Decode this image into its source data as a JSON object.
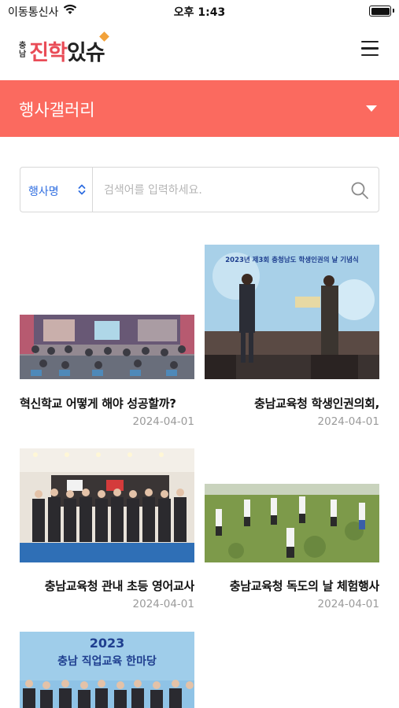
{
  "status": {
    "carrier": "이동통신사",
    "time": "오후 1:43"
  },
  "header": {
    "logo_small_top": "충",
    "logo_small_bottom": "남",
    "logo_main_1": "진학",
    "logo_main_2": "있슈",
    "menu_icon": "hamburger-menu-icon"
  },
  "section": {
    "title": "행사갤러리",
    "dropdown_icon": "caret-down-icon"
  },
  "search": {
    "category_selected": "행사명",
    "placeholder": "검색어를 입력하세요.",
    "value": ""
  },
  "gallery": [
    {
      "title": "혁신학교 어떻게 해야 성공할까?",
      "date": "2024-04-01",
      "image_text": ""
    },
    {
      "title": "충남교육청 학생인권의회,",
      "date": "2024-04-01",
      "image_text": "2023년 제3회 충청남도 학생인권의 날 기념식"
    },
    {
      "title": "충남교육청 관내 초등 영어교사",
      "date": "2024-04-01",
      "image_text": ""
    },
    {
      "title": "충남교육청 독도의 날 체험행사",
      "date": "2024-04-01",
      "image_text": ""
    },
    {
      "title": "",
      "date": "",
      "image_text_1": "2023",
      "image_text_2": "충남 직업교육 한마당"
    }
  ],
  "colors": {
    "accent": "#fb6a5f",
    "select_text": "#2e6de0",
    "date": "#9a9a9a"
  }
}
